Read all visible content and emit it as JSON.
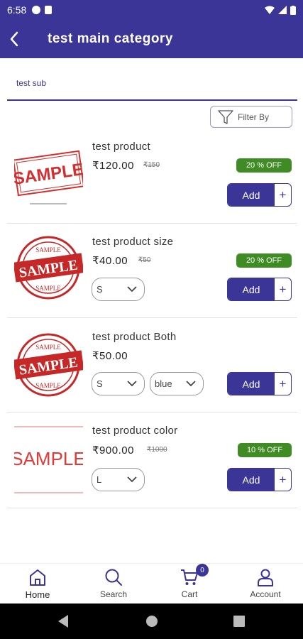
{
  "status_bar": {
    "time": "6:58"
  },
  "app_bar": {
    "title": "test main  category"
  },
  "tabs": [
    {
      "label": "test sub"
    }
  ],
  "filter": {
    "label": "Filter By"
  },
  "colors": {
    "primary": "#3a3596",
    "discount": "#3f8c25"
  },
  "products": [
    {
      "name": "test product",
      "price": "₹120.00",
      "mrp": "₹150",
      "discount": "20 % OFF",
      "add_label": "Add",
      "plus": "+",
      "image": "sample-red-stamp",
      "selects": []
    },
    {
      "name": "test product size",
      "price": "₹40.00",
      "mrp": "₹50",
      "discount": "20 % OFF",
      "add_label": "Add",
      "plus": "+",
      "image": "sample-round-stamp",
      "selects": [
        "S"
      ]
    },
    {
      "name": "test product Both",
      "price": "₹50.00",
      "mrp": "",
      "discount": "",
      "add_label": "Add",
      "plus": "+",
      "image": "sample-round-stamp",
      "selects": [
        "S",
        "blue"
      ]
    },
    {
      "name": "test product color",
      "price": "₹900.00",
      "mrp": "₹1000",
      "discount": "10 % OFF",
      "add_label": "Add",
      "plus": "+",
      "image": "sample-text",
      "selects": [
        "L"
      ]
    }
  ],
  "bottom_nav": {
    "items": [
      {
        "label": "Home",
        "icon": "home-icon"
      },
      {
        "label": "Search",
        "icon": "search-icon"
      },
      {
        "label": "Cart",
        "icon": "cart-icon",
        "badge": "0"
      },
      {
        "label": "Account",
        "icon": "account-icon"
      }
    ]
  }
}
